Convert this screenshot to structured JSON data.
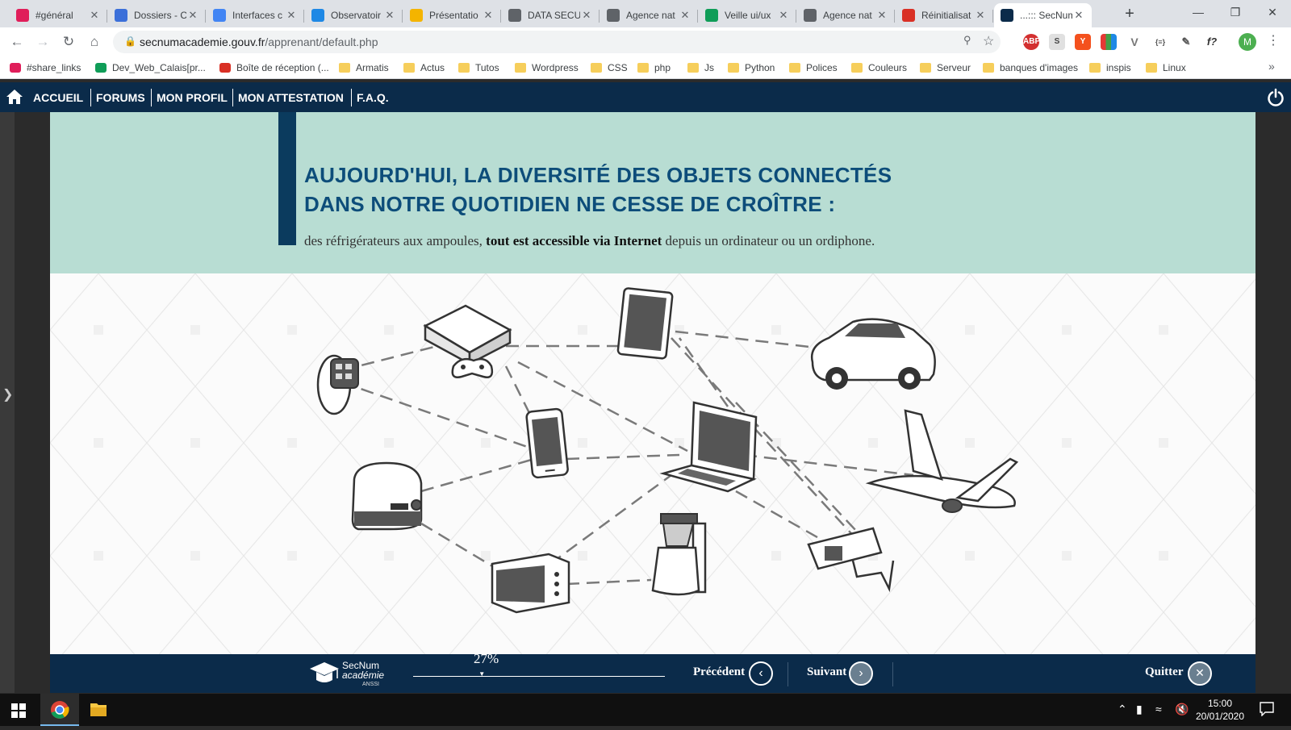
{
  "browser": {
    "tabs": [
      {
        "title": "#général",
        "favicon": "slack-icon",
        "color": "#e01e5a"
      },
      {
        "title": "Dossiers - C",
        "favicon": "c-icon",
        "color": "#3b6fd9"
      },
      {
        "title": "Interfaces c",
        "favicon": "docs-icon",
        "color": "#4285f4"
      },
      {
        "title": "Observatoir",
        "favicon": "site-icon",
        "color": "#1e88e5"
      },
      {
        "title": "Présentatio",
        "favicon": "slides-icon",
        "color": "#f4b400"
      },
      {
        "title": "DATA SECU",
        "favicon": "gear-icon",
        "color": "#5f6368"
      },
      {
        "title": "Agence nat",
        "favicon": "globe-icon",
        "color": "#5f6368"
      },
      {
        "title": "Veille ui/ux",
        "favicon": "drive-icon",
        "color": "#0f9d58"
      },
      {
        "title": "Agence nat",
        "favicon": "globe-icon",
        "color": "#5f6368"
      },
      {
        "title": "Réinitialisat",
        "favicon": "gmail-icon",
        "color": "#d93025"
      },
      {
        "title": "...::: SecNum",
        "favicon": "graduation-cap-icon",
        "color": "#0b2b4a"
      }
    ],
    "active_tab_index": 10,
    "url_domain": "secnumacademie.gouv.fr",
    "url_path": "/apprenant/default.php",
    "profile_initial": "M",
    "extensions": [
      "ABP",
      "S",
      "Y",
      "multicolor",
      "V",
      "{≡}",
      "pen",
      "f?"
    ],
    "bookmarks": [
      {
        "label": "#share_links",
        "icon": "slack-icon"
      },
      {
        "label": "Dev_Web_Calais[pr...",
        "icon": "drive-icon"
      },
      {
        "label": "Boîte de réception (...",
        "icon": "gmail-icon"
      },
      {
        "label": "Armatis",
        "icon": "folder-icon"
      },
      {
        "label": "Actus",
        "icon": "folder-icon"
      },
      {
        "label": "Tutos",
        "icon": "folder-icon"
      },
      {
        "label": "Wordpress",
        "icon": "folder-icon"
      },
      {
        "label": "CSS",
        "icon": "folder-icon"
      },
      {
        "label": "php",
        "icon": "folder-icon"
      },
      {
        "label": "Js",
        "icon": "folder-icon"
      },
      {
        "label": "Python",
        "icon": "folder-icon"
      },
      {
        "label": "Polices",
        "icon": "folder-icon"
      },
      {
        "label": "Couleurs",
        "icon": "folder-icon"
      },
      {
        "label": "Serveur",
        "icon": "folder-icon"
      },
      {
        "label": "banques d'images",
        "icon": "folder-icon"
      },
      {
        "label": "inspis",
        "icon": "folder-icon"
      },
      {
        "label": "Linux",
        "icon": "folder-icon"
      }
    ]
  },
  "site_nav": {
    "items": [
      "ACCUEIL",
      "FORUMS",
      "MON PROFIL",
      "MON ATTESTATION",
      "F.A.Q."
    ],
    "background": "#0b2b4a"
  },
  "lesson": {
    "headline_line1": "AUJOURD'HUI, LA DIVERSITÉ DES OBJETS CONNECTÉS",
    "headline_line2": "DANS NOTRE QUOTIDIEN NE CESSE DE CROÎTRE :",
    "subline_before": "des réfrigérateurs aux ampoules, ",
    "subline_bold": "tout est accessible via Internet",
    "subline_after": " depuis un ordinateur ou un ordiphone.",
    "band_color": "#b8ddd3",
    "headline_color": "#0d4d7a",
    "illustration_objects": [
      "smartwatch",
      "game-console",
      "tablet",
      "car",
      "smartphone",
      "laptop",
      "airplane",
      "toaster",
      "coffee-maker",
      "security-camera",
      "mini-oven"
    ]
  },
  "player": {
    "logo_title": "SecNum",
    "logo_subtitle": "académie",
    "logo_org": "ANSSI",
    "progress_label": "27%",
    "progress": 0.27,
    "prev_label": "Précédent",
    "next_label": "Suivant",
    "quit_label": "Quitter"
  },
  "taskbar": {
    "time": "15:00",
    "date": "20/01/2020",
    "pinned": [
      "chrome-icon",
      "file-explorer-icon"
    ]
  }
}
